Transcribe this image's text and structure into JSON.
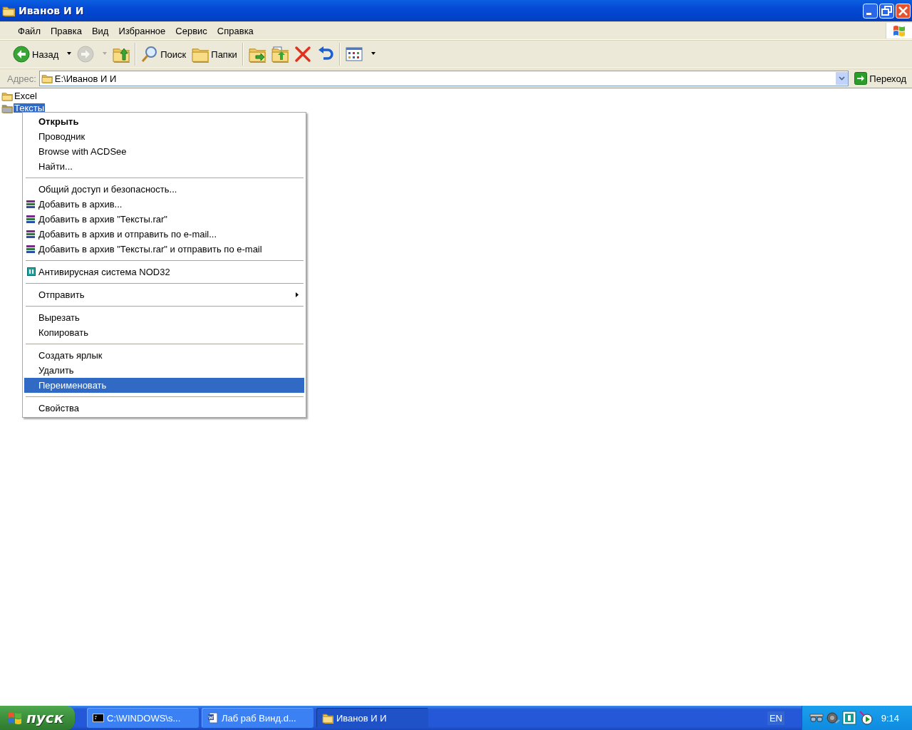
{
  "window": {
    "title": "Иванов И И"
  },
  "menubar": [
    "Файл",
    "Правка",
    "Вид",
    "Избранное",
    "Сервис",
    "Справка"
  ],
  "toolbar": [
    {
      "kind": "back",
      "label": "Назад",
      "disabled": false
    },
    {
      "kind": "forward",
      "disabled": true
    },
    {
      "kind": "up",
      "disabled": false
    },
    {
      "kind": "search",
      "label": "Поиск",
      "disabled": false
    },
    {
      "kind": "folders",
      "label": "Папки",
      "disabled": false
    },
    {
      "kind": "move",
      "disabled": false
    },
    {
      "kind": "copy",
      "disabled": false
    },
    {
      "kind": "delete",
      "disabled": false
    },
    {
      "kind": "undo",
      "disabled": false
    },
    {
      "kind": "views",
      "disabled": false
    }
  ],
  "address": {
    "label": "Адрес:",
    "value": "E:\\Иванов И И",
    "go": "Переход"
  },
  "files": [
    {
      "name": "Excel",
      "selected": false
    },
    {
      "name": "Тексты",
      "selected": true
    }
  ],
  "context_menu": [
    {
      "kind": "item",
      "label": "Открыть",
      "default": true,
      "selected": false
    },
    {
      "kind": "item",
      "label": "Проводник",
      "default": false,
      "selected": false
    },
    {
      "kind": "item",
      "label": "Browse with ACDSee",
      "default": false,
      "selected": false
    },
    {
      "kind": "item",
      "label": "Найти...",
      "default": false,
      "selected": false
    },
    {
      "kind": "separator"
    },
    {
      "kind": "item",
      "label": "Общий доступ и безопасность...",
      "default": false,
      "selected": false
    },
    {
      "kind": "archive",
      "label": "Добавить в архив...",
      "default": false,
      "selected": false
    },
    {
      "kind": "archive",
      "label": "Добавить в архив \"Тексты.rar\"",
      "default": false,
      "selected": false
    },
    {
      "kind": "archive",
      "label": "Добавить в архив и отправить по e-mail...",
      "default": false,
      "selected": false
    },
    {
      "kind": "archive",
      "label": "Добавить в архив \"Тексты.rar\" и отправить по e-mail",
      "default": false,
      "selected": false
    },
    {
      "kind": "separator"
    },
    {
      "kind": "antivirus",
      "label": "Антивирусная система NOD32",
      "default": false,
      "selected": false
    },
    {
      "kind": "separator"
    },
    {
      "kind": "submenu",
      "label": "Отправить",
      "default": false,
      "selected": false
    },
    {
      "kind": "separator"
    },
    {
      "kind": "item",
      "label": "Вырезать",
      "default": false,
      "selected": false
    },
    {
      "kind": "item",
      "label": "Копировать",
      "default": false,
      "selected": false
    },
    {
      "kind": "separator"
    },
    {
      "kind": "item",
      "label": "Создать ярлык",
      "default": false,
      "selected": false
    },
    {
      "kind": "item",
      "label": "Удалить",
      "default": false,
      "selected": false
    },
    {
      "kind": "item",
      "label": "Переименовать",
      "default": false,
      "selected": true
    },
    {
      "kind": "separator"
    },
    {
      "kind": "item",
      "label": "Свойства",
      "default": false,
      "selected": false
    }
  ],
  "taskbar": {
    "start": "пуск",
    "tasks": [
      {
        "kind": "console",
        "label": "C:\\WINDOWS\\s...",
        "selected": false
      },
      {
        "kind": "document",
        "label": "Лаб раб Винд.d...",
        "selected": false
      },
      {
        "kind": "folder",
        "label": "Иванов И И",
        "selected": true
      }
    ],
    "language": "EN",
    "clock": "9:14"
  }
}
